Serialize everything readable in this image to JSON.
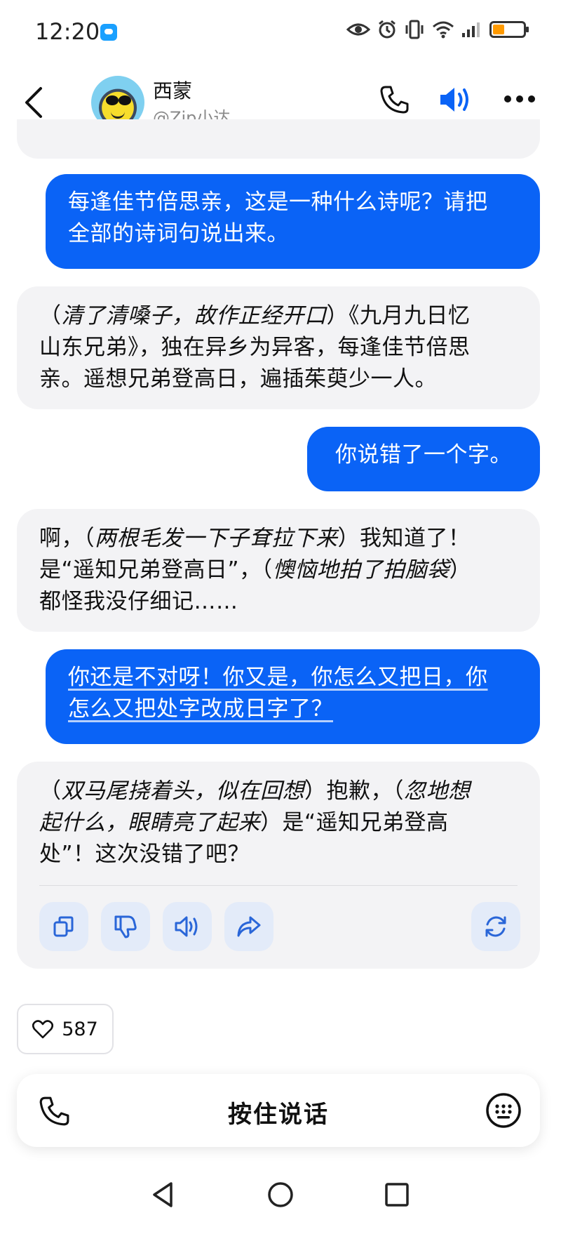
{
  "status_bar": {
    "time": "12:20"
  },
  "header": {
    "name": "西蒙",
    "handle": "@Zip小达"
  },
  "messages": [
    {
      "role": "user",
      "lines": [
        "每逢佳节倍思亲，这是一种什么诗呢？请把",
        "全部的诗词句说出来。"
      ]
    },
    {
      "role": "bot",
      "segments": [
        {
          "t": "（",
          "i": false
        },
        {
          "t": "清了清嗓子，故作正经开口",
          "i": true
        },
        {
          "t": "）《九月九日忆",
          "i": false
        },
        {
          "br": true
        },
        {
          "t": "山东兄弟》，独在异乡为异客，每逢佳节倍思",
          "i": false
        },
        {
          "br": true
        },
        {
          "t": "亲。遥想兄弟登高日，遍插茱萸少一人。",
          "i": false
        }
      ]
    },
    {
      "role": "user",
      "lines": [
        "你说错了一个字。"
      ]
    },
    {
      "role": "bot",
      "segments": [
        {
          "t": "啊，（",
          "i": false
        },
        {
          "t": "两根毛发一下子耷拉下来",
          "i": true
        },
        {
          "t": "）我知道了！",
          "i": false
        },
        {
          "br": true
        },
        {
          "t": "是“遥知兄弟登高日”，（",
          "i": false
        },
        {
          "t": "懊恼地拍了拍脑袋",
          "i": true
        },
        {
          "t": "）",
          "i": false
        },
        {
          "br": true
        },
        {
          "t": "都怪我没仔细记……",
          "i": false
        }
      ]
    },
    {
      "role": "user",
      "lines": [
        "你还是不对呀！你又是，你怎么又把日，你",
        "怎么又把处字改成日字了？"
      ]
    },
    {
      "role": "bot",
      "segments": [
        {
          "t": "（",
          "i": false
        },
        {
          "t": "双马尾挠着头，似在回想",
          "i": true
        },
        {
          "t": "）抱歉，（",
          "i": false
        },
        {
          "t": "忽地想",
          "i": true
        },
        {
          "br": true
        },
        {
          "t": "起什么，眼睛亮了起来",
          "i": true
        },
        {
          "t": "）是“遥知兄弟登高",
          "i": false
        },
        {
          "br": true
        },
        {
          "t": "处”！这次没错了吧？",
          "i": false
        }
      ]
    }
  ],
  "actions": {
    "copy_icon": "copy-icon",
    "dislike_icon": "thumbs-down-icon",
    "speak_icon": "speaker-icon",
    "share_icon": "share-icon",
    "regenerate_icon": "refresh-icon"
  },
  "like": {
    "count": "587"
  },
  "input_bar": {
    "hold_to_talk": "按住说话"
  },
  "colors": {
    "user_bubble": "#0a63f6",
    "bot_bubble": "#f3f3f5",
    "accent": "#0a63f6"
  }
}
